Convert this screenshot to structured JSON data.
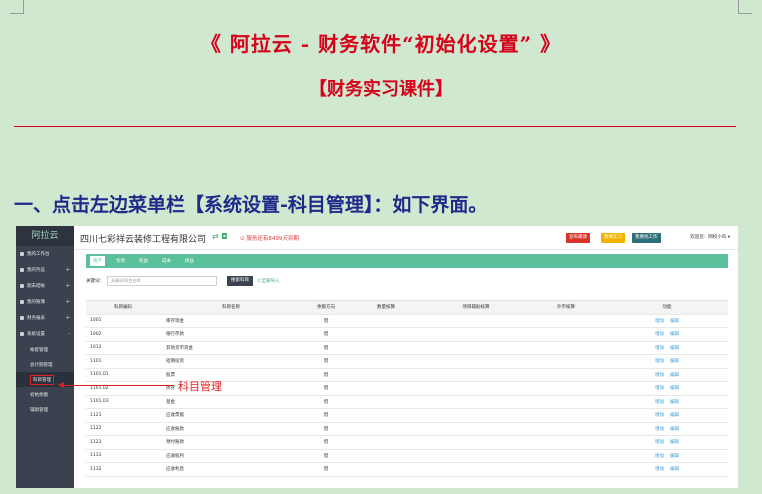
{
  "document": {
    "title": "《 阿拉云 - 财务软件“初始化设置” 》",
    "subtitle": "【财务实习课件】",
    "instruction": "一、点击左边菜单栏【系统设置-科目管理】：如下界面。"
  },
  "app": {
    "logo": "阿拉云",
    "company": "四川七彩祥云装修工程有限公司",
    "company_icons": "⇄ ◘",
    "alert": "⊙ 服务还有8499天到期",
    "buttons": {
      "b1": "宣布邀请",
      "b2": "我要实习",
      "b3": "我要找工作"
    },
    "welcome": "欢迎您：网校小鸟 ▾",
    "colors": {
      "accent": "#5bc19a",
      "sidebar": "#3a4250",
      "annotation": "#e02020"
    }
  },
  "sidebar": {
    "items": [
      {
        "label": "我的工作台",
        "icon": "home-icon"
      },
      {
        "label": "我的凭证",
        "icon": "gear-icon",
        "expander": "+"
      },
      {
        "label": "期末结帐",
        "icon": "gear-icon",
        "expander": "+"
      },
      {
        "label": "我的账簿",
        "icon": "gear-icon",
        "expander": "+"
      },
      {
        "label": "财务报表",
        "icon": "gear-icon",
        "expander": "+"
      },
      {
        "label": "系统设置",
        "icon": "gear-icon",
        "expander": "-"
      }
    ],
    "subitems": [
      {
        "label": "帐套管理"
      },
      {
        "label": "会计期管理"
      },
      {
        "label": "科目管理",
        "active": true
      },
      {
        "label": "初始余额"
      },
      {
        "label": "辅助管理"
      }
    ]
  },
  "callout": "科目管理",
  "tabs": [
    "资产",
    "负债",
    "权益",
    "成本",
    "损益"
  ],
  "search": {
    "label": "关键词：",
    "placeholder": "关键词/科目名称",
    "button": "搜索科目",
    "import": "Ⓒ全部导入"
  },
  "table": {
    "headers": [
      "科目编码",
      "科目名称",
      "余额方向",
      "数量核算",
      "项目辅助核算",
      "外币核算",
      "功能"
    ],
    "action_labels": [
      "增加",
      "编辑"
    ],
    "rows": [
      {
        "code": "1001",
        "name": "库存现金",
        "dir": "借"
      },
      {
        "code": "1002",
        "name": "银行存款",
        "dir": "借"
      },
      {
        "code": "1012",
        "name": "其他货币资金",
        "dir": "借"
      },
      {
        "code": "1101",
        "name": "短期投资",
        "dir": "借"
      },
      {
        "code": "1101.01",
        "name": "股票",
        "dir": "借"
      },
      {
        "code": "1101.02",
        "name": "债券",
        "dir": "借"
      },
      {
        "code": "1101.03",
        "name": "基金",
        "dir": "借"
      },
      {
        "code": "1121",
        "name": "应收票据",
        "dir": "借"
      },
      {
        "code": "1122",
        "name": "应收账款",
        "dir": "借"
      },
      {
        "code": "1123",
        "name": "预付账款",
        "dir": "借"
      },
      {
        "code": "1131",
        "name": "应收股利",
        "dir": "借"
      },
      {
        "code": "1132",
        "name": "应收利息",
        "dir": "借"
      }
    ]
  }
}
